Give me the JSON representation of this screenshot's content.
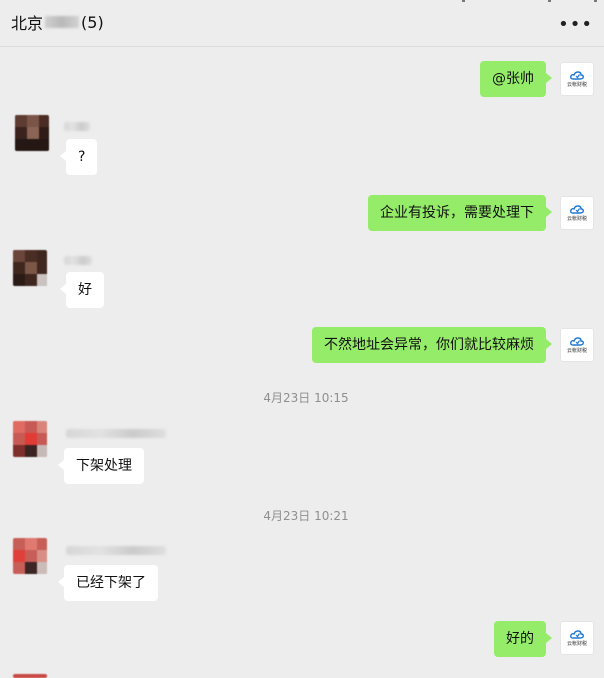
{
  "header": {
    "title_prefix": "北京",
    "title_suffix": "(5)",
    "more_icon": "•••"
  },
  "colors": {
    "background": "#ededed",
    "my_bubble": "#95ec69",
    "other_bubble": "#ffffff",
    "timestamp": "#8f8f8f"
  },
  "messages": [
    {
      "from": "me",
      "text": "@张帅"
    },
    {
      "from": "other",
      "text": "?"
    },
    {
      "from": "me",
      "text": "企业有投诉，需要处理下"
    },
    {
      "from": "other",
      "text": "好"
    },
    {
      "from": "me",
      "text": "不然地址会异常，你们就比较麻烦"
    },
    {
      "from": "other",
      "text": "下架处理"
    },
    {
      "from": "other",
      "text": "已经下架了"
    },
    {
      "from": "me",
      "text": "好的"
    }
  ],
  "timestamps": [
    "4月23日 10:15",
    "4月23日 10:21"
  ],
  "my_avatar": {
    "icon": "cloud-logo-icon",
    "brand_text": "云帐财税"
  }
}
